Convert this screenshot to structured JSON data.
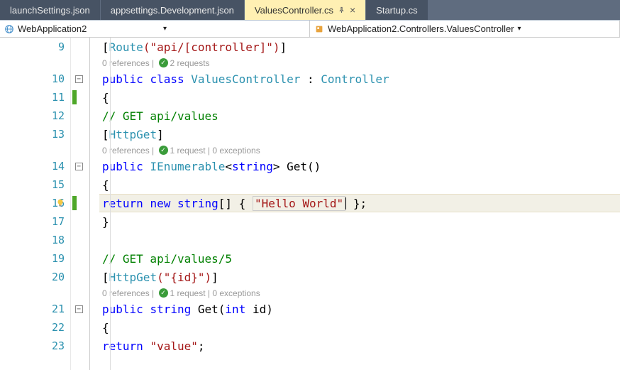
{
  "tabs": {
    "t0": "launchSettings.json",
    "t1": "appsettings.Development.json",
    "t2": "ValuesController.cs",
    "t3": "Startup.cs"
  },
  "nav": {
    "left": "WebApplication2",
    "right": "WebApplication2.Controllers.ValuesController"
  },
  "lens": {
    "l1_a": "0 references",
    "l1_b": "2 requests",
    "l2_a": "0 references",
    "l2_b": "1 request",
    "l2_c": "0 exceptions",
    "l3_a": "0 references",
    "l3_b": "1 request",
    "l3_c": "0 exceptions",
    "sep": " | "
  },
  "lines": {
    "n9": "9",
    "n10": "10",
    "n11": "11",
    "n12": "12",
    "n13": "13",
    "n14": "14",
    "n15": "15",
    "n16": "16",
    "n17": "17",
    "n18": "18",
    "n19": "19",
    "n20": "20",
    "n21": "21",
    "n22": "22",
    "n23": "23"
  },
  "code": {
    "route_open": "[",
    "route_name": "Route",
    "route_arg": "(\"api/[controller]\")",
    "route_close": "]",
    "pub": "public",
    "cls": "class",
    "ctrl_name": "ValuesController",
    "colon": " : ",
    "base": "Controller",
    "brace_o": "{",
    "brace_c": "}",
    "cmt_get": "// GET api/values",
    "httpget": "HttpGet",
    "httpget_open": "[",
    "httpget_close": "]",
    "ienum": "IEnumerable",
    "str_t": "string",
    "get": "Get",
    "parens": "()",
    "ret": "return",
    "new": "new",
    "arr_open": "[] { ",
    "hello": "\"Hello World\"",
    "arr_close": " };",
    "cmt_get5": "// GET api/values/5",
    "httpget_id": "(\"{id}\")",
    "int": "int",
    "id": " id",
    "paren_o": "(",
    "paren_c": ")",
    "value": "\"value\"",
    "semi": ";",
    "sp": " "
  }
}
